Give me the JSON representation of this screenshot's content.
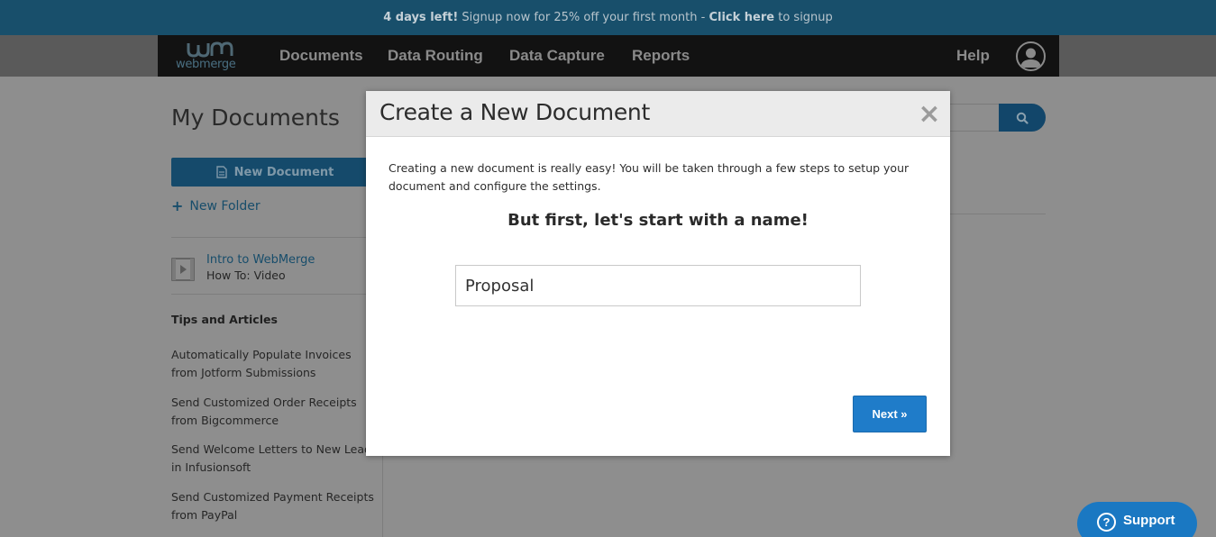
{
  "promo": {
    "days_left": "4 days left!",
    "message": " Signup now for 25% off your first month - ",
    "cta": "Click here",
    "suffix": " to signup"
  },
  "nav": {
    "logo_text": "webmerge",
    "links": [
      "Documents",
      "Data Routing",
      "Data Capture",
      "Reports"
    ],
    "help": "Help",
    "user_icon": "user-avatar-icon"
  },
  "sidebar": {
    "title": "My Documents",
    "new_document": "New Document",
    "new_folder": "New Folder",
    "video": {
      "title": "Intro to WebMerge",
      "subtitle": "How To: Video"
    },
    "tips_heading": "Tips and Articles",
    "articles": [
      [
        "Automatically Populate Invoices",
        "from Jotform Submissions"
      ],
      [
        "Send Customized Order Receipts",
        "from Bigcommerce"
      ],
      [
        "Send Welcome Letters to New Leads",
        "in Infusionsoft"
      ],
      [
        "Send Customized Payment Receipts",
        "from PayPal"
      ]
    ]
  },
  "support": {
    "label": "Support"
  },
  "modal": {
    "title": "Create a New Document",
    "close": "×",
    "description": "Creating a new document is really easy! You will be taken through a few steps to setup your document and configure the settings.",
    "subheading": "But first, let's start with a name!",
    "name_value": "Proposal",
    "next_label": "Next »"
  },
  "colors": {
    "promo_bg": "#184f6b",
    "nav_bg": "#121212",
    "accent": "#1f7cc9",
    "overlay": "#8e8e8e"
  }
}
